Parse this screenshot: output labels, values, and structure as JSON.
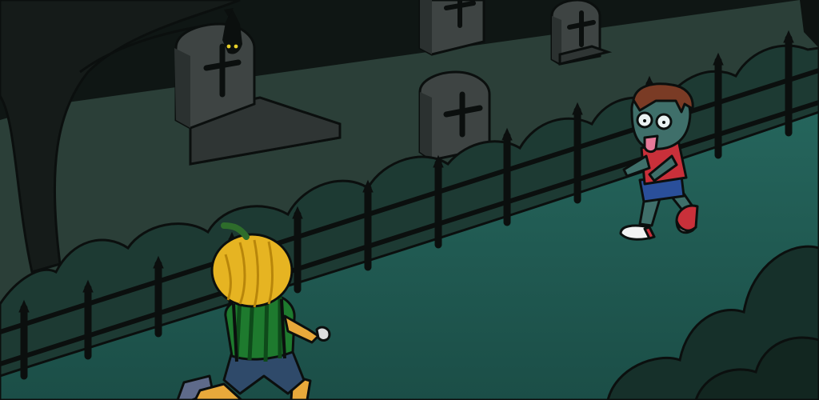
{
  "scene": {
    "setting": "graveyard-night",
    "palette": {
      "sky": "#0f1614",
      "tree": "#151b19",
      "graveyard_ground": "#2b3f38",
      "path": "#1f5a52",
      "hedge": "#1d3a33",
      "fence": "#0c0f0e",
      "tombstone": "#3e4443",
      "tombstone_dark": "#2b3130",
      "pumpkin": "#e6b422",
      "shirt_green": "#1e7a2e",
      "zombie_skin": "#3f6f6a",
      "zombie_shirt": "#c9303a",
      "zombie_hair": "#7a3b25"
    },
    "characters": [
      {
        "name": "pumpkin-head-boy",
        "role": "player"
      },
      {
        "name": "zombie-boy",
        "role": "enemy"
      },
      {
        "name": "bat",
        "role": "decoration"
      }
    ],
    "props": [
      "tombstone",
      "tombstone",
      "tombstone",
      "tombstone",
      "iron-fence",
      "hedge",
      "dead-tree"
    ]
  }
}
